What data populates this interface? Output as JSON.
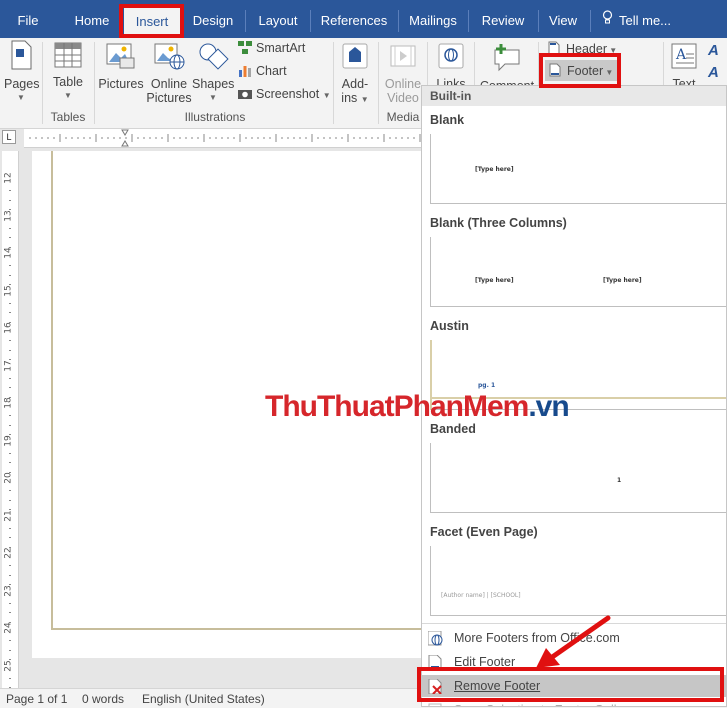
{
  "tabs": [
    {
      "label": "File"
    },
    {
      "label": "Home"
    },
    {
      "label": "Insert"
    },
    {
      "label": "Design"
    },
    {
      "label": "Layout"
    },
    {
      "label": "References"
    },
    {
      "label": "Mailings"
    },
    {
      "label": "Review"
    },
    {
      "label": "View"
    }
  ],
  "tell_me": "Tell me...",
  "ribbon": {
    "pages": "Pages",
    "table": "Table",
    "pictures": "Pictures",
    "online_pictures_1": "Online",
    "online_pictures_2": "Pictures",
    "shapes": "Shapes",
    "smartart": "SmartArt",
    "chart": "Chart",
    "screenshot": "Screenshot",
    "addins_1": "Add-",
    "addins_2": "ins",
    "online_video_1": "Online",
    "online_video_2": "Video",
    "links": "Links",
    "comment": "Comment",
    "header": "Header",
    "footer": "Footer",
    "text": "Text",
    "groups": {
      "tables": "Tables",
      "illustrations": "Illustrations",
      "media": "Media"
    }
  },
  "ruler": {
    "vertical_numbers": [
      "12",
      "13",
      "14",
      "15",
      "16",
      "17",
      "18",
      "19",
      "20",
      "21",
      "22",
      "23",
      "24",
      "25"
    ]
  },
  "dropdown": {
    "section": "Built-in",
    "gallery": [
      {
        "title": "Blank",
        "placeholders": [
          "[Type here]"
        ]
      },
      {
        "title": "Blank (Three Columns)",
        "placeholders": [
          "[Type here]",
          "[Type here]"
        ]
      },
      {
        "title": "Austin",
        "placeholders": [
          "pg. 1"
        ]
      },
      {
        "title": "Banded",
        "placeholders": [
          "1"
        ]
      },
      {
        "title": "Facet (Even Page)",
        "placeholders": [
          "[Author name] | [SCHOOL]"
        ]
      }
    ],
    "menu": [
      {
        "label": "More Footers from Office.com"
      },
      {
        "label": "Edit Footer"
      },
      {
        "label": "Remove Footer"
      },
      {
        "label": "Save Selection to Footer Gallery..."
      }
    ]
  },
  "status": {
    "page": "Page 1 of 1",
    "words": "0 words",
    "language": "English (United States)"
  },
  "watermark": {
    "part1": "ThuThuat",
    "part2": "PhanMem",
    "part3": ".vn"
  },
  "colors": {
    "accent": "#2b579a",
    "highlight_box": "#e01010",
    "arrow": "#e01010"
  }
}
